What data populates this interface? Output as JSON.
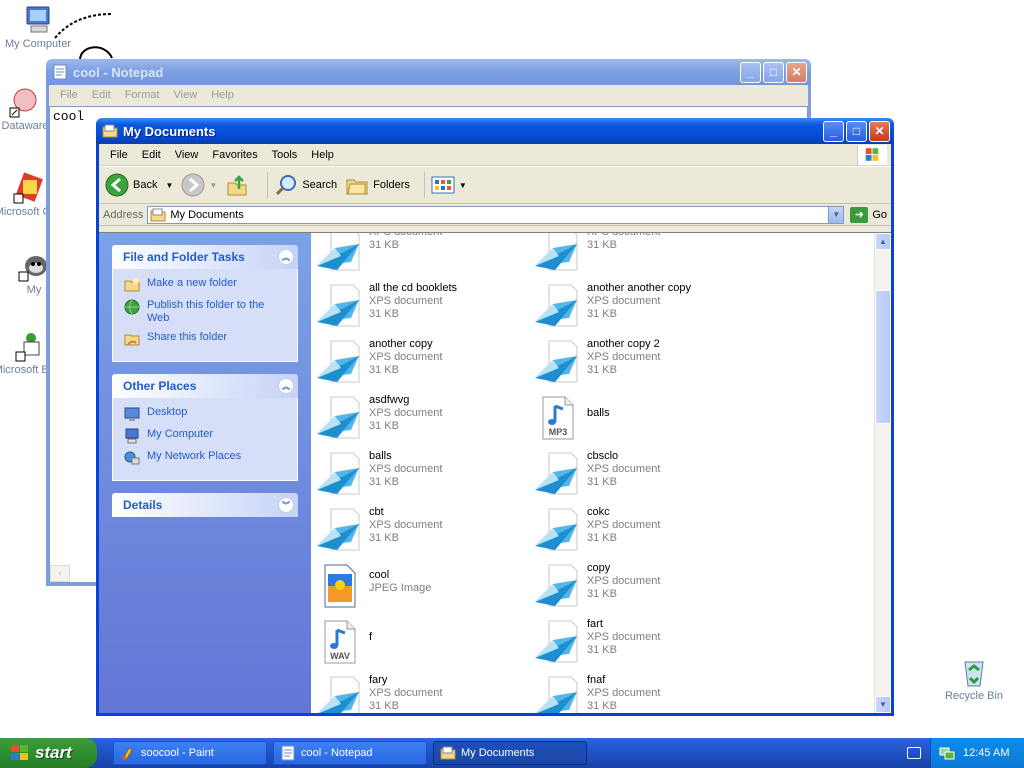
{
  "desktop": {
    "icons": [
      {
        "label": "My Computer",
        "icon": "computer-icon"
      },
      {
        "label": "Dataware",
        "icon": "dataware-shortcut-icon"
      },
      {
        "label": "Microsoft C++",
        "icon": "visual-cpp-shortcut-icon"
      },
      {
        "label": "My",
        "icon": "raccoon-shortcut-icon"
      },
      {
        "label": "Microsoft Basic",
        "icon": "visual-basic-shortcut-icon"
      },
      {
        "label": "Recycle Bin",
        "icon": "recycle-bin-icon"
      }
    ]
  },
  "notepad": {
    "title": "cool - Notepad",
    "menu": [
      "File",
      "Edit",
      "Format",
      "View",
      "Help"
    ],
    "content": "cool"
  },
  "explorer": {
    "title": "My Documents",
    "menu": [
      "File",
      "Edit",
      "View",
      "Favorites",
      "Tools",
      "Help"
    ],
    "toolbar": {
      "back": "Back",
      "search": "Search",
      "folders": "Folders"
    },
    "address": {
      "label": "Address",
      "value": "My Documents",
      "go": "Go"
    },
    "task_panels": [
      {
        "title": "File and Folder Tasks",
        "items": [
          "Make a new folder",
          "Publish this folder to the Web",
          "Share this folder"
        ]
      },
      {
        "title": "Other Places",
        "items": [
          "Desktop",
          "My Computer",
          "My Network Places"
        ]
      },
      {
        "title": "Details",
        "items": []
      }
    ],
    "files": [
      {
        "name": "",
        "type": "XPS document",
        "size": "31 KB",
        "icon": "xps-icon"
      },
      {
        "name": "",
        "type": "XPS document",
        "size": "31 KB",
        "icon": "xps-icon"
      },
      {
        "name": "all the cd booklets",
        "type": "XPS document",
        "size": "31 KB",
        "icon": "xps-icon"
      },
      {
        "name": "another another copy",
        "type": "XPS document",
        "size": "31 KB",
        "icon": "xps-icon"
      },
      {
        "name": "another copy",
        "type": "XPS document",
        "size": "31 KB",
        "icon": "xps-icon"
      },
      {
        "name": "another copy 2",
        "type": "XPS document",
        "size": "31 KB",
        "icon": "xps-icon"
      },
      {
        "name": "asdfwvg",
        "type": "XPS document",
        "size": "31 KB",
        "icon": "xps-icon"
      },
      {
        "name": "balls",
        "type": "",
        "size": "",
        "icon": "mp3-icon"
      },
      {
        "name": "balls",
        "type": "XPS document",
        "size": "31 KB",
        "icon": "xps-icon"
      },
      {
        "name": "cbsclo",
        "type": "XPS document",
        "size": "31 KB",
        "icon": "xps-icon"
      },
      {
        "name": "cbt",
        "type": "XPS document",
        "size": "31 KB",
        "icon": "xps-icon"
      },
      {
        "name": "cokc",
        "type": "XPS document",
        "size": "31 KB",
        "icon": "xps-icon"
      },
      {
        "name": "cool",
        "type": "JPEG Image",
        "size": "",
        "icon": "jpeg-icon"
      },
      {
        "name": "copy",
        "type": "XPS document",
        "size": "31 KB",
        "icon": "xps-icon"
      },
      {
        "name": "f",
        "type": "",
        "size": "",
        "icon": "wav-icon"
      },
      {
        "name": "fart",
        "type": "XPS document",
        "size": "31 KB",
        "icon": "xps-icon"
      },
      {
        "name": "fary",
        "type": "XPS document",
        "size": "31 KB",
        "icon": "xps-icon"
      },
      {
        "name": "fnaf",
        "type": "XPS document",
        "size": "31 KB",
        "icon": "xps-icon"
      }
    ],
    "file_badges": {
      "mp3": "MP3",
      "wav": "WAV"
    }
  },
  "taskbar": {
    "start": "start",
    "tasks": [
      {
        "label": "soocool - Paint",
        "icon": "paint-icon"
      },
      {
        "label": "cool - Notepad",
        "icon": "notepad-icon"
      },
      {
        "label": "My Documents",
        "icon": "folder-icon"
      }
    ],
    "clock": "12:45 AM"
  }
}
